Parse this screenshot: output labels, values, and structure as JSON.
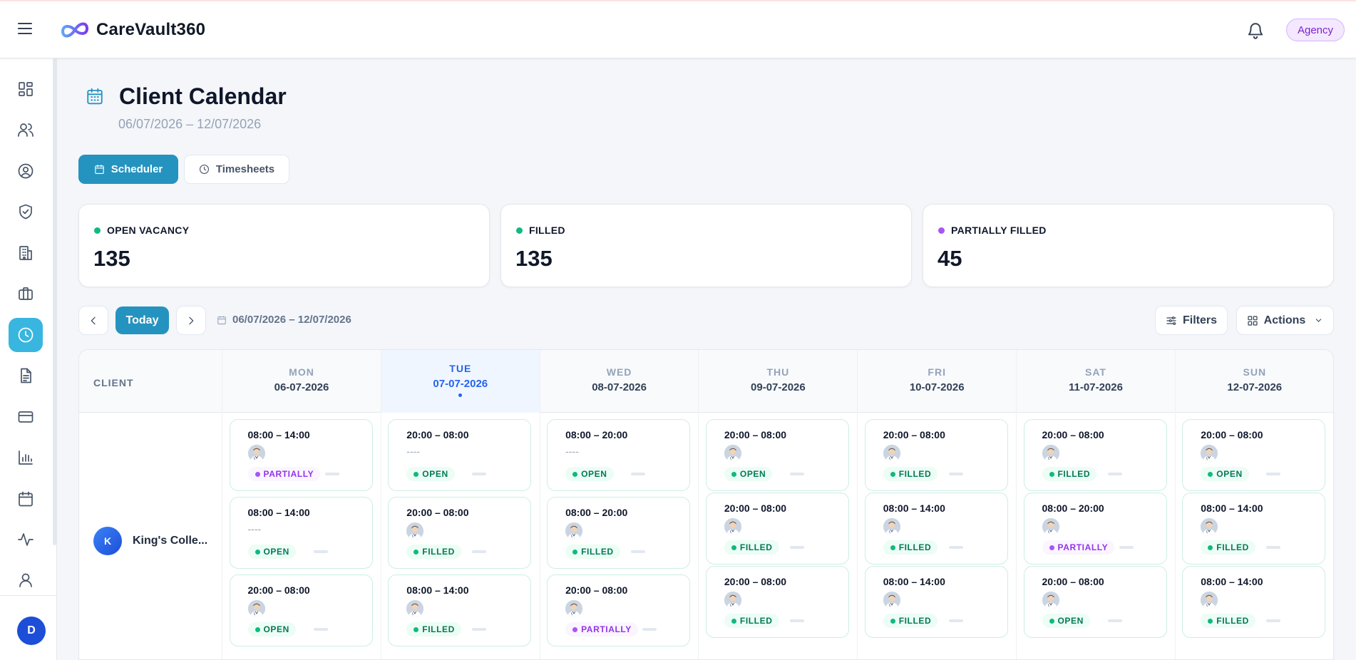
{
  "header": {
    "brand": "CareVault360",
    "agency_badge": "Agency"
  },
  "sidebar": {
    "items": [
      {
        "name": "dashboard-icon"
      },
      {
        "name": "users-icon"
      },
      {
        "name": "user-circle-icon"
      },
      {
        "name": "shield-check-icon"
      },
      {
        "name": "building-icon"
      },
      {
        "name": "briefcase-icon"
      },
      {
        "name": "clock-icon",
        "active": true
      },
      {
        "name": "document-icon"
      },
      {
        "name": "credit-card-icon"
      },
      {
        "name": "bar-chart-icon"
      },
      {
        "name": "calendar-icon"
      },
      {
        "name": "activity-icon"
      },
      {
        "name": "user-icon"
      }
    ],
    "user_initial": "D",
    "active_color": "#38b6e0"
  },
  "page": {
    "title": "Client Calendar",
    "date_range": "06/07/2026 – 12/07/2026"
  },
  "tabs": {
    "scheduler": "Scheduler",
    "timesheets": "Timesheets"
  },
  "stats": [
    {
      "label": "OPEN VACANCY",
      "value": "135",
      "color": "#10b981"
    },
    {
      "label": "FILLED",
      "value": "135",
      "color": "#10b981"
    },
    {
      "label": "PARTIALLY FILLED",
      "value": "45",
      "color": "#a855f7"
    }
  ],
  "toolbar": {
    "today": "Today",
    "range": "06/07/2026 – 12/07/2026",
    "filters": "Filters",
    "actions": "Actions"
  },
  "calendar": {
    "client_header": "CLIENT",
    "days": [
      {
        "name": "MON",
        "date": "06-07-2026"
      },
      {
        "name": "TUE",
        "date": "07-07-2026",
        "today": true
      },
      {
        "name": "WED",
        "date": "08-07-2026"
      },
      {
        "name": "THU",
        "date": "09-07-2026"
      },
      {
        "name": "FRI",
        "date": "10-07-2026"
      },
      {
        "name": "SAT",
        "date": "11-07-2026"
      },
      {
        "name": "SUN",
        "date": "12-07-2026"
      }
    ],
    "client": {
      "initial": "K",
      "name": "King's Colle..."
    },
    "shifts": [
      [
        {
          "time": "08:00 – 14:00",
          "staff": true,
          "status": "PARTIALLY"
        },
        {
          "time": "08:00 – 14:00",
          "staff": false,
          "empty_text": "----",
          "status": "OPEN"
        },
        {
          "time": "20:00 – 08:00",
          "staff": true,
          "status": "OPEN"
        }
      ],
      [
        {
          "time": "20:00 – 08:00",
          "staff": false,
          "empty_text": "----",
          "status": "OPEN"
        },
        {
          "time": "20:00 – 08:00",
          "staff": true,
          "status": "FILLED"
        },
        {
          "time": "08:00 – 14:00",
          "staff": true,
          "status": "FILLED"
        }
      ],
      [
        {
          "time": "08:00 – 20:00",
          "staff": false,
          "empty_text": "----",
          "status": "OPEN"
        },
        {
          "time": "08:00 – 20:00",
          "staff": true,
          "status": "FILLED"
        },
        {
          "time": "20:00 – 08:00",
          "staff": true,
          "status": "PARTIALLY"
        }
      ],
      [
        {
          "time": "20:00 – 08:00",
          "staff": true,
          "status": "OPEN"
        },
        {
          "time": "20:00 – 08:00",
          "staff": true,
          "status": "FILLED"
        },
        {
          "time": "20:00 – 08:00",
          "staff": true,
          "status": "FILLED"
        }
      ],
      [
        {
          "time": "20:00 – 08:00",
          "staff": true,
          "status": "FILLED"
        },
        {
          "time": "08:00 – 14:00",
          "staff": true,
          "status": "FILLED"
        },
        {
          "time": "08:00 – 14:00",
          "staff": true,
          "status": "FILLED"
        }
      ],
      [
        {
          "time": "20:00 – 08:00",
          "staff": true,
          "status": "FILLED"
        },
        {
          "time": "08:00 – 20:00",
          "staff": true,
          "status": "PARTIALLY"
        },
        {
          "time": "20:00 – 08:00",
          "staff": true,
          "status": "OPEN"
        }
      ],
      [
        {
          "time": "20:00 – 08:00",
          "staff": true,
          "status": "OPEN"
        },
        {
          "time": "08:00 – 14:00",
          "staff": true,
          "status": "FILLED"
        },
        {
          "time": "08:00 – 14:00",
          "staff": true,
          "status": "FILLED"
        }
      ]
    ]
  }
}
